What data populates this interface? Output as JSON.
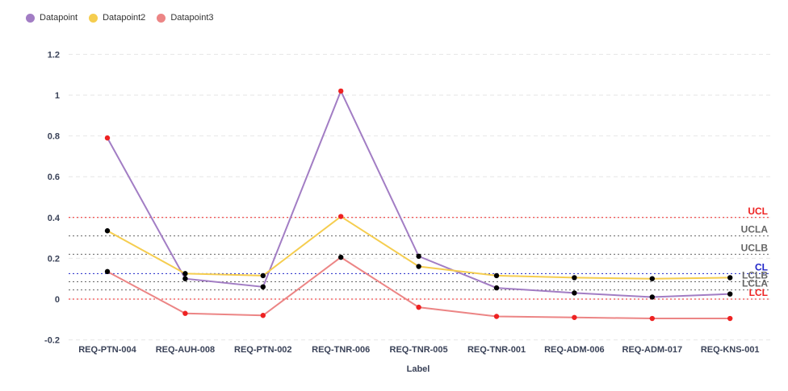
{
  "chart_data": {
    "type": "line",
    "xlabel": "Label",
    "ylabel": "",
    "ylim": [
      -0.2,
      1.2
    ],
    "yticks": [
      "-0.2",
      "0",
      "0.2",
      "0.4",
      "0.6",
      "0.8",
      "1",
      "1.2"
    ],
    "grid": true,
    "legend_position": "top-left",
    "categories": [
      "REQ-PTN-004",
      "REQ-AUH-008",
      "REQ-PTN-002",
      "REQ-TNR-006",
      "REQ-TNR-005",
      "REQ-TNR-001",
      "REQ-ADM-006",
      "REQ-ADM-017",
      "REQ-KNS-001"
    ],
    "series": [
      {
        "name": "Datapoint",
        "color": "#a27dc4",
        "values": [
          0.79,
          0.1,
          0.06,
          1.02,
          0.21,
          0.055,
          0.03,
          0.01,
          0.025
        ]
      },
      {
        "name": "Datapoint2",
        "color": "#f5cd4f",
        "values": [
          0.335,
          0.125,
          0.115,
          0.405,
          0.16,
          0.115,
          0.105,
          0.1,
          0.105
        ]
      },
      {
        "name": "Datapoint3",
        "color": "#ec8585",
        "values": [
          0.135,
          -0.07,
          -0.08,
          0.205,
          -0.04,
          -0.085,
          -0.09,
          -0.095,
          -0.095
        ]
      }
    ],
    "control_lines": [
      {
        "label": "UCL",
        "value": 0.4,
        "color": "#ee2222"
      },
      {
        "label": "UCLA",
        "value": 0.31,
        "color": "#666666"
      },
      {
        "label": "UCLB",
        "value": 0.22,
        "color": "#666666"
      },
      {
        "label": "CL",
        "value": 0.125,
        "color": "#1f24c8"
      },
      {
        "label": "LCLB",
        "value": 0.085,
        "color": "#666666"
      },
      {
        "label": "LCLA",
        "value": 0.045,
        "color": "#666666"
      },
      {
        "label": "LCL",
        "value": 0.0,
        "color": "#ee2222"
      }
    ],
    "point_colors": {
      "in_control": "#000000",
      "out_of_control": "#ee2222"
    }
  }
}
